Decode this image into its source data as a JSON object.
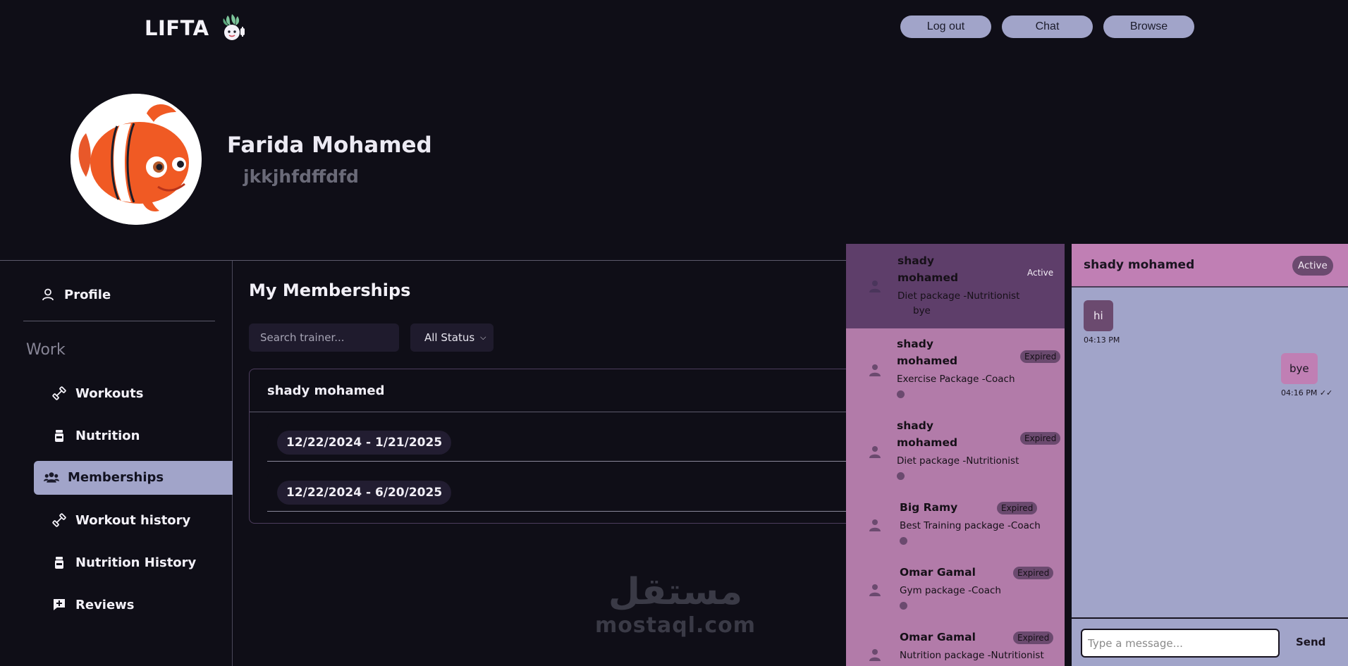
{
  "app": {
    "name": "LIFTA"
  },
  "nav": {
    "logout": "Log out",
    "chat": "Chat",
    "browse": "Browse"
  },
  "profile": {
    "name": "Farida Mohamed",
    "bio": "jkkjhfdffdfd"
  },
  "sidebar": {
    "profile": "Profile",
    "section": "Work",
    "items": [
      {
        "label": "Workouts",
        "icon": "dumbbell-icon"
      },
      {
        "label": "Nutrition",
        "icon": "supplement-icon"
      },
      {
        "label": "Memberships",
        "icon": "users-icon"
      },
      {
        "label": "Workout history",
        "icon": "dumbbell-icon"
      },
      {
        "label": "Nutrition History",
        "icon": "supplement-icon"
      },
      {
        "label": "Reviews",
        "icon": "review-icon"
      }
    ]
  },
  "main": {
    "title": "My Memberships",
    "search_placeholder": "Search trainer...",
    "status_filter": "All Status",
    "membership": {
      "trainer": "shady mohamed",
      "periods": [
        "12/22/2024 - 1/21/2025",
        "12/22/2024 - 6/20/2025"
      ]
    }
  },
  "watermark": {
    "arabic": "مستقل",
    "site": "mostaql.com"
  },
  "chat_list": [
    {
      "name_line1": "shady",
      "name_line2": "mohamed",
      "package": "Diet package -Nutritionist",
      "status": "Active",
      "last": "bye"
    },
    {
      "name_line1": "shady",
      "name_line2": "mohamed",
      "package": "Exercise Package -Coach",
      "status": "Expired"
    },
    {
      "name_line1": "shady",
      "name_line2": "mohamed",
      "package": "Diet package -Nutritionist",
      "status": "Expired"
    },
    {
      "name_line1": "Big Ramy",
      "package": "Best Training package -Coach",
      "status": "Expired"
    },
    {
      "name_line1": "Omar Gamal",
      "package": "Gym package -Coach",
      "status": "Expired"
    },
    {
      "name_line1": "Omar Gamal",
      "package": "Nutrition package -Nutritionist",
      "status": "Expired"
    }
  ],
  "chat": {
    "name": "shady mohamed",
    "status": "Active",
    "messages": [
      {
        "text": "hi",
        "time": "04:13 PM"
      },
      {
        "text": "bye",
        "time": "04:16 PM ✓✓"
      }
    ],
    "input_placeholder": "Type a message...",
    "send": "Send"
  },
  "colors": {
    "background": "#0f0e17",
    "accent": "#a1a4c9",
    "chat_pink": "#b27ba9",
    "chat_selected": "#5e3e6a"
  }
}
